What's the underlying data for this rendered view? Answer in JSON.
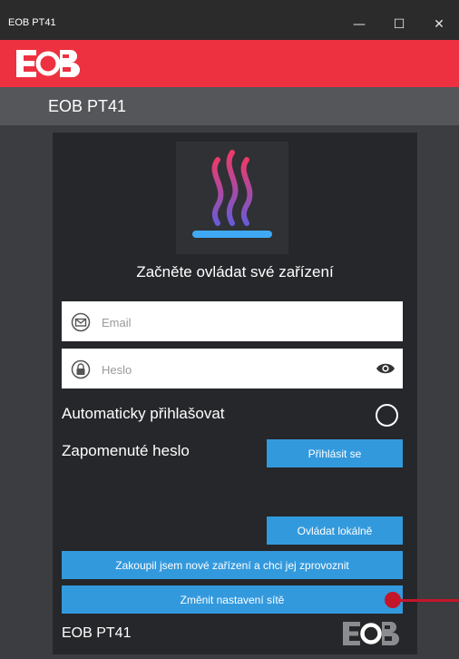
{
  "window": {
    "title": "EOB PT41",
    "minimize_glyph": "—",
    "maximize_glyph": "☐",
    "close_glyph": "✕"
  },
  "brand": {
    "logo_icon": "eob-logo-icon",
    "bar_color": "#ed3140"
  },
  "header": {
    "title": "EOB PT41"
  },
  "hero": {
    "icon": "heating-icon"
  },
  "login": {
    "subtitle": "Začněte ovládat své zařízení",
    "email_placeholder": "Email",
    "password_placeholder": "Heslo",
    "auto_login_label": "Automaticky přihlašovat",
    "forgot_password_label": "Zapomenuté heslo",
    "sign_in_button": "Přihlásit se"
  },
  "actions": {
    "local_control_button": "Ovládat lokálně",
    "new_device_button": "Zakoupil jsem nové zařízení a chci jej zprovoznit",
    "change_network_button": "Změnit nastavení sítě"
  },
  "footer": {
    "title": "EOB PT41"
  },
  "colors": {
    "accent": "#3399dd",
    "brand_red": "#ed3140",
    "panel": "#25272a",
    "callout": "#c4162a"
  }
}
